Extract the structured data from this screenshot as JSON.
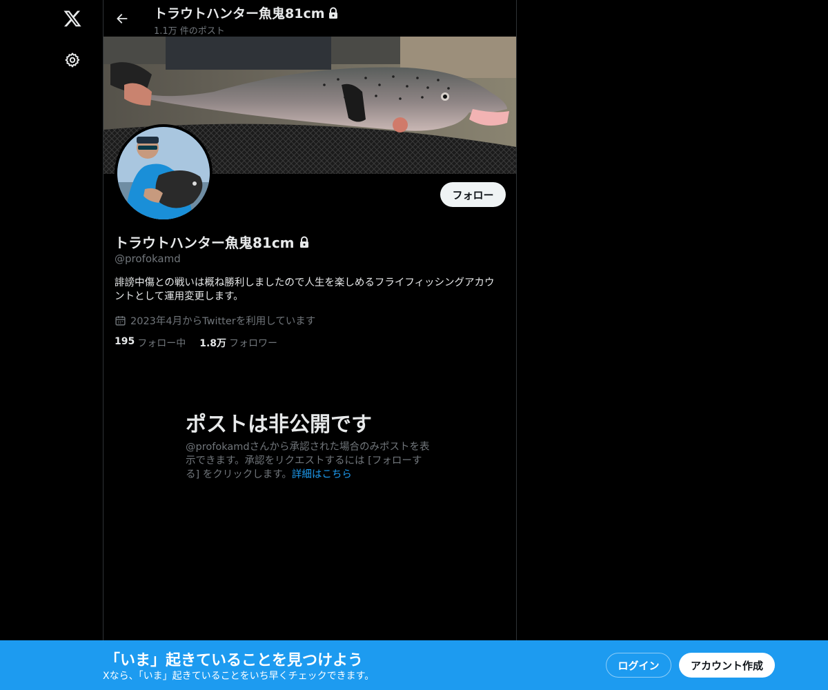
{
  "header": {
    "title": "トラウトハンター魚鬼81cm",
    "post_count": "1.1万 件のポスト"
  },
  "profile": {
    "name": "トラウトハンター魚鬼81cm",
    "handle": "@profokamd",
    "bio": "誹謗中傷との戦いは概ね勝利しましたので人生を楽しめるフライフィッシングアカウントとして運用変更します。",
    "joined": "2023年4月からTwitterを利用しています",
    "following_count": "195",
    "following_label": "フォロー中",
    "followers_count": "1.8万",
    "followers_label": "フォロワー",
    "follow_button": "フォロー"
  },
  "private_notice": {
    "title": "ポストは非公開です",
    "description": "@profokamdさんから承認された場合のみポストを表示できます。承認をリクエストするには [フォローする] をクリックします。",
    "link_text": "詳細はこちら"
  },
  "bottom_bar": {
    "title": "「いま」起きていることを見つけよう",
    "subtitle": "Xなら、「いま」起きていることをいち早くチェックできます。",
    "login_button": "ログイン",
    "signup_button": "アカウント作成"
  },
  "icons": {
    "logo": "x-logo-icon",
    "settings": "gear-icon",
    "back": "arrow-left-icon",
    "lock": "lock-icon",
    "calendar": "calendar-icon"
  },
  "colors": {
    "background": "#000000",
    "accent": "#1d9bf0",
    "text_primary": "#e7e9ea",
    "text_secondary": "#71767b",
    "border": "#2f3336"
  }
}
